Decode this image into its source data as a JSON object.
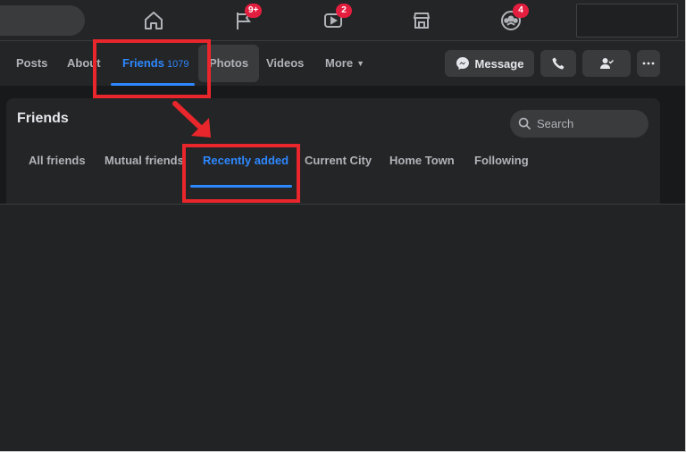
{
  "top_nav": {
    "icons": [
      {
        "name": "home-icon",
        "badge": ""
      },
      {
        "name": "pages-flag-icon",
        "badge": "9+"
      },
      {
        "name": "watch-video-icon",
        "badge": "2"
      },
      {
        "name": "marketplace-icon",
        "badge": ""
      },
      {
        "name": "groups-icon",
        "badge": "4"
      }
    ]
  },
  "profile_tabs": {
    "posts": "Posts",
    "about": "About",
    "friends": "Friends",
    "friends_count": "1079",
    "photos": "Photos",
    "videos": "Videos",
    "more": "More"
  },
  "profile_actions": {
    "message": "Message"
  },
  "friends_section": {
    "title": "Friends",
    "search_placeholder": "Search",
    "tabs": [
      "All friends",
      "Mutual friends",
      "Recently added",
      "Current City",
      "Home Town",
      "Following"
    ],
    "active_tab": "Recently added"
  },
  "colors": {
    "background": "#18191a",
    "surface": "#242526",
    "accent": "#2d88ff",
    "annotation": "#e8262b",
    "badge": "#e41e3f"
  }
}
